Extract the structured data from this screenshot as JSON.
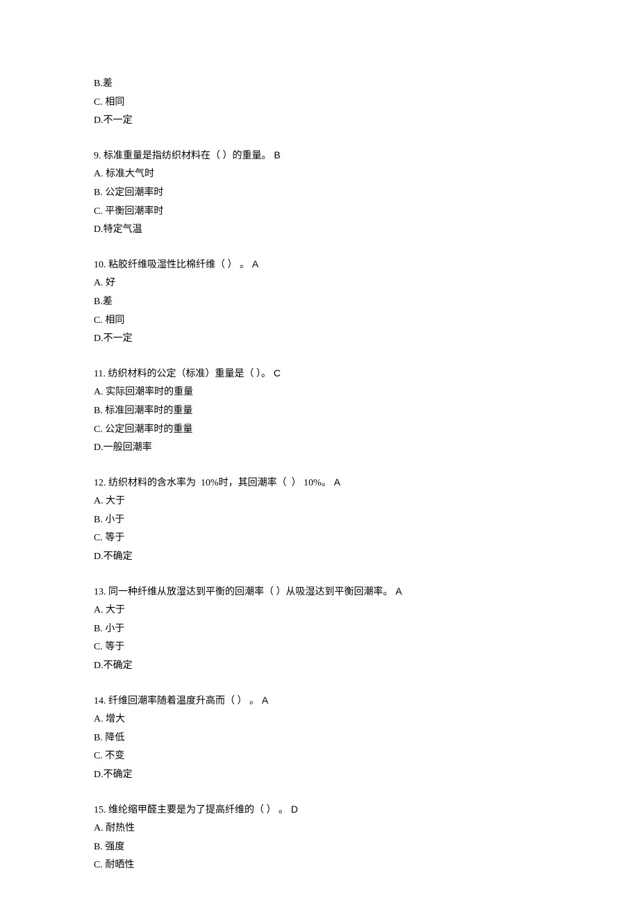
{
  "q8": {
    "b": "B.差",
    "c": "C. 相同",
    "d": "D.不一定"
  },
  "q9": {
    "stem_pre": "9. 标准重量是指纺织材料在（ ）的重量。",
    "ans": " B",
    "a": "A. 标准大气时",
    "b": "B. 公定回潮率时",
    "c": "C. 平衡回潮率时",
    "d": "D.特定气温"
  },
  "q10": {
    "stem_pre": "10. 粘胶纤维吸湿性比棉纤维（ ） 。",
    "ans": " A",
    "a": "A. 好",
    "b": "B.差",
    "c": "C. 相同",
    "d": "D.不一定"
  },
  "q11": {
    "stem_pre": "11. 纺织材料的公定（标准）重量是（ ）。",
    "ans": " C",
    "a": "A. 实际回潮率时的重量",
    "b": "B. 标准回潮率时的重量",
    "c": "C. 公定回潮率时的重量",
    "d": "D.一般回潮率"
  },
  "q12": {
    "stem_pre": "12. 纺织材料的含水率为  10%时，其回潮率（  ） 10%。",
    "ans": " A",
    "a": "A. 大于",
    "b": "B. 小于",
    "c": "C. 等于",
    "d": "D.不确定"
  },
  "q13": {
    "stem_pre": "13. 同一种纤维从放湿达到平衡的回潮率（ ）从吸湿达到平衡回潮率。",
    "ans": " A",
    "a": "A. 大于",
    "b": "B. 小于",
    "c": "C. 等于",
    "d": "D.不确定"
  },
  "q14": {
    "stem_pre": "14. 纤维回潮率随着温度升高而（ ） 。",
    "ans": " A",
    "a": "A. 增大",
    "b": "B. 降低",
    "c": "C. 不变",
    "d": "D.不确定"
  },
  "q15": {
    "stem_pre": "15. 维纶缩甲醛主要是为了提高纤维的（ ） 。",
    "ans": " D",
    "a": "A. 耐热性",
    "b": "B. 强度",
    "c": "C. 耐晒性"
  }
}
